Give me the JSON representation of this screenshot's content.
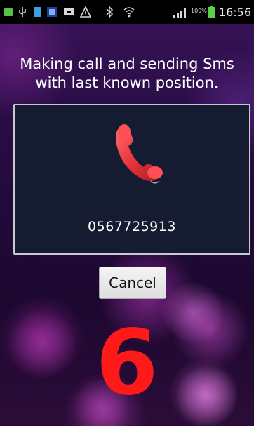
{
  "status_bar": {
    "time": "16:56",
    "battery_percent": "100%",
    "icons": [
      "notification-icon",
      "usb-icon",
      "sim-icon",
      "app-icon",
      "media-icon",
      "warning-icon",
      "bluetooth-icon",
      "wifi-icon",
      "signal-icon",
      "battery-icon"
    ]
  },
  "message": {
    "line1": "Making call and sending Sms",
    "line2": "with last known position."
  },
  "call_panel": {
    "icon": "phone-handset-icon",
    "phone_number": "0567725913"
  },
  "cancel_button": {
    "label": "Cancel"
  },
  "countdown": {
    "value": "6"
  },
  "colors": {
    "countdown": "#ff1a1a",
    "phone_icon": "#e8353b",
    "panel_background": "#151c32",
    "panel_border": "#c9c9cf"
  }
}
